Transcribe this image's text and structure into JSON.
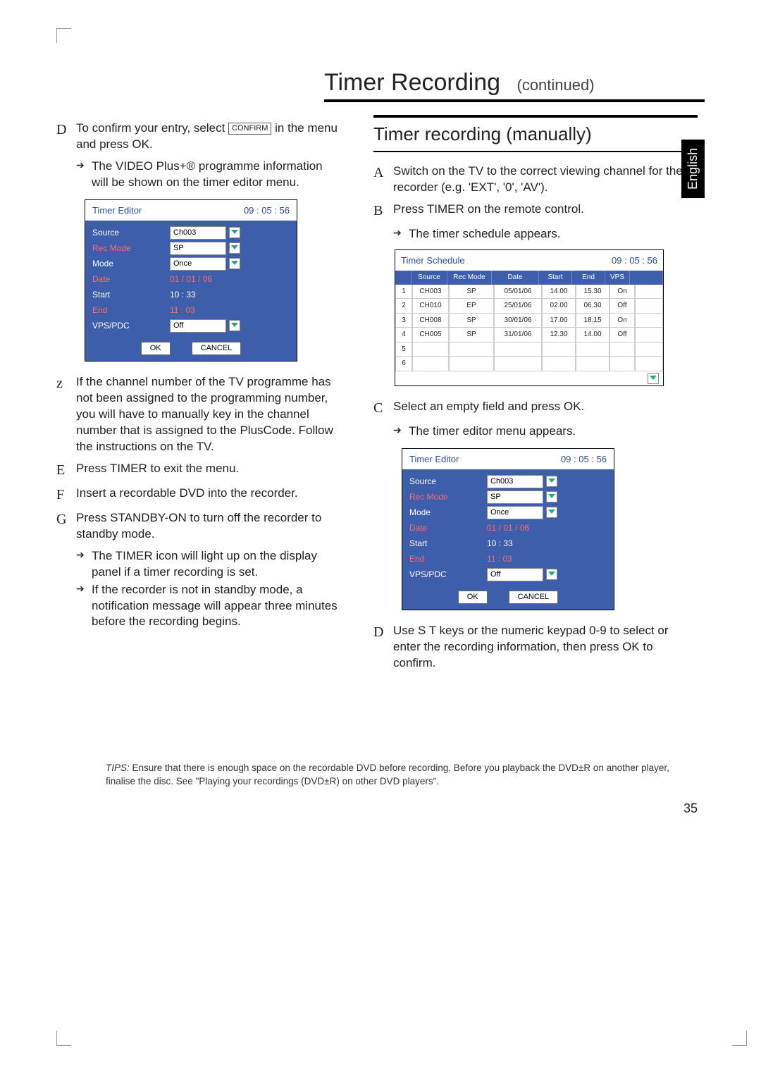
{
  "title": "Timer Recording",
  "continued": "(continued)",
  "language_tab": "English",
  "page_number": "35",
  "left": {
    "D": "To confirm your entry, select ",
    "D_btn": "CONFIRM",
    "D2": " in the menu and press OK.",
    "D_sub": "The VIDEO Plus+® programme information will be shown on the timer editor menu.",
    "Z": "If the channel number of the TV programme has not been assigned to the programming number, you will have to manually key in the channel number that is assigned to the PlusCode. Follow the instructions on the TV.",
    "E": "Press TIMER to exit the menu.",
    "F": "Insert a recordable DVD into the recorder.",
    "G": "Press STANDBY-ON to turn off the recorder to standby mode.",
    "G_sub1": "The TIMER icon will light up on the display panel if a timer recording is set.",
    "G_sub2": "If the recorder is not in standby mode, a notification message will appear three minutes before the recording begins."
  },
  "right": {
    "subhead": "Timer recording (manually)",
    "A": "Switch on the TV to the correct viewing channel for the recorder (e.g. 'EXT', '0', 'AV').",
    "B": "Press TIMER on the remote control.",
    "B_sub": "The timer schedule appears.",
    "C": "Select an empty field and press OK.",
    "C_sub": "The timer editor menu appears.",
    "D": "Use S T keys or the numeric keypad 0-9 to select or enter the recording information, then press OK to confirm."
  },
  "editor": {
    "title": "Timer Editor",
    "time": "09 : 05 : 56",
    "labels": {
      "source": "Source",
      "recmode": "Rec Mode",
      "mode": "Mode",
      "date": "Date",
      "start": "Start",
      "end": "End",
      "vps": "VPS/PDC"
    },
    "values": {
      "source": "Ch003",
      "recmode": "SP",
      "mode": "Once",
      "date": "01 / 01 / 06",
      "start": "10 : 33",
      "end": "11 : 03",
      "vps": "Off"
    },
    "ok": "OK",
    "cancel": "CANCEL"
  },
  "schedule": {
    "title": "Timer Schedule",
    "time": "09 : 05 : 56",
    "headers": {
      "source": "Source",
      "recmode": "Rec Mode",
      "date": "Date",
      "start": "Start",
      "end": "End",
      "vps": "VPS"
    },
    "rows": [
      {
        "idx": "1",
        "source": "CH003",
        "mode": "SP",
        "date": "05/01/06",
        "start": "14.00",
        "end": "15.30",
        "vps": "On"
      },
      {
        "idx": "2",
        "source": "CH010",
        "mode": "EP",
        "date": "25/01/06",
        "start": "02.00",
        "end": "06.30",
        "vps": "Off"
      },
      {
        "idx": "3",
        "source": "CH008",
        "mode": "SP",
        "date": "30/01/06",
        "start": "17.00",
        "end": "18.15",
        "vps": "On"
      },
      {
        "idx": "4",
        "source": "CH005",
        "mode": "SP",
        "date": "31/01/06",
        "start": "12.30",
        "end": "14.00",
        "vps": "Off"
      },
      {
        "idx": "5",
        "source": "",
        "mode": "",
        "date": "",
        "start": "",
        "end": "",
        "vps": ""
      },
      {
        "idx": "6",
        "source": "",
        "mode": "",
        "date": "",
        "start": "",
        "end": "",
        "vps": ""
      }
    ]
  },
  "tips": {
    "label": "TIPS:",
    "text": "Ensure that there is enough space on the recordable DVD before recording. Before you playback the DVD±R on another player, finalise the disc. See \"Playing your recordings (DVD±R) on other DVD players\"."
  }
}
